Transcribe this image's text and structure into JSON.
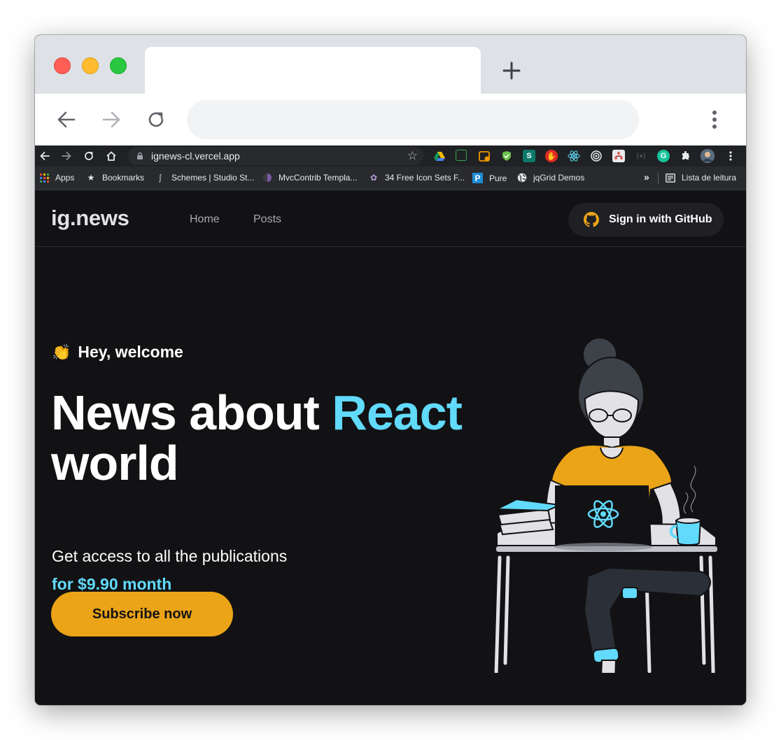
{
  "browser": {
    "url": "ignews-cl.vercel.app",
    "bookmarks": [
      {
        "label": "Apps",
        "icon": "apps-grid-icon"
      },
      {
        "label": "Bookmarks",
        "icon": "star-icon"
      },
      {
        "label": "Schemes | Studio St...",
        "icon": "schemes-icon"
      },
      {
        "label": "MvcContrib Templa...",
        "icon": "mvccontrib-icon"
      },
      {
        "label": "34 Free Icon Sets F...",
        "icon": "icon-sets-icon"
      },
      {
        "label": "Pure",
        "icon": "pure-p-icon"
      },
      {
        "label": "jqGrid Demos",
        "icon": "globe-icon"
      }
    ],
    "overflow_label": "»",
    "reading_list_label": "Lista de leitura"
  },
  "site": {
    "logo": "ig.news",
    "nav": [
      {
        "label": "Home"
      },
      {
        "label": "Posts"
      }
    ],
    "signin_label": "Sign in with GitHub"
  },
  "hero": {
    "emoji": "👏",
    "welcome": "Hey, welcome",
    "headline_part1": "News about ",
    "headline_accent": "React",
    "headline_part2": "world",
    "subtitle": "Get access to all the publications",
    "price": "for $9.90 month",
    "cta": "Subscribe now"
  },
  "colors": {
    "background": "#121214",
    "accent_cyan": "#61dafb",
    "accent_yellow": "#eba417",
    "header_border": "#29292e"
  }
}
